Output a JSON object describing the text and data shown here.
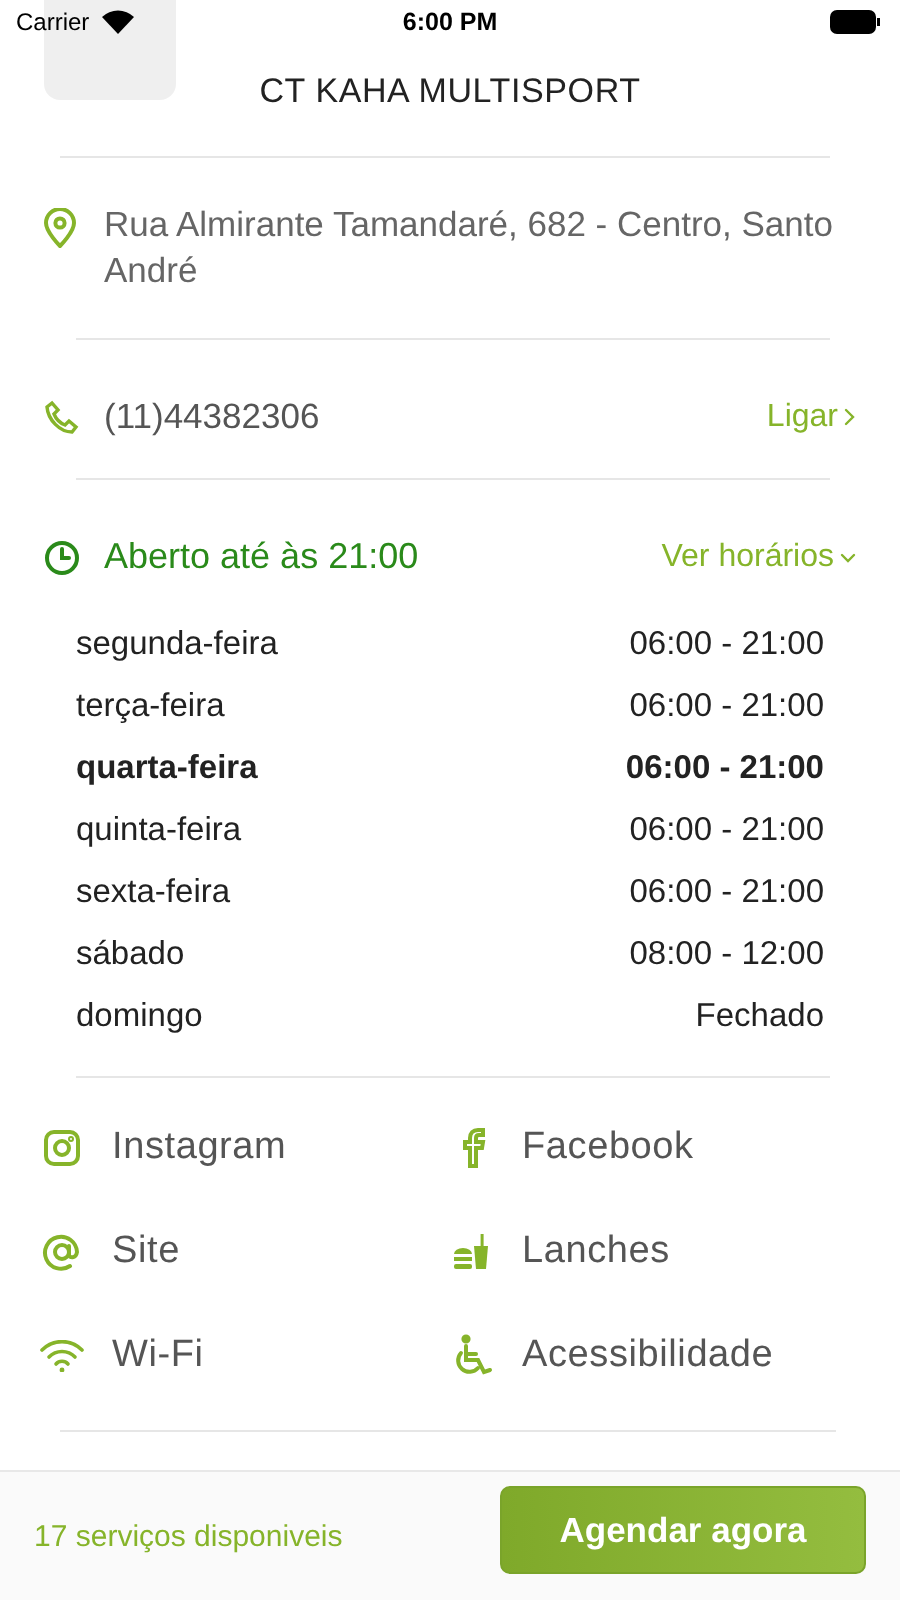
{
  "status_bar": {
    "carrier": "Carrier",
    "time": "6:00 PM"
  },
  "header": {
    "title": "CT KAHA MULTISPORT"
  },
  "address": {
    "text": "Rua Almirante Tamandaré, 682 - Centro, Santo André"
  },
  "phone": {
    "number": "(11)44382306",
    "action": "Ligar"
  },
  "hours": {
    "status": "Aberto até às 21:00",
    "toggle": "Ver horários",
    "expanded": true,
    "days": [
      {
        "day": "segunda-feira",
        "time": "06:00 - 21:00",
        "selected": false
      },
      {
        "day": "terça-feira",
        "time": "06:00 - 21:00",
        "selected": false
      },
      {
        "day": "quarta-feira",
        "time": "06:00 - 21:00",
        "selected": true
      },
      {
        "day": "quinta-feira",
        "time": "06:00 - 21:00",
        "selected": false
      },
      {
        "day": "sexta-feira",
        "time": "06:00 - 21:00",
        "selected": false
      },
      {
        "day": "sábado",
        "time": "08:00 - 12:00",
        "selected": false
      },
      {
        "day": "domingo",
        "time": "Fechado",
        "selected": false
      }
    ]
  },
  "amenities": [
    {
      "kind": "instagram",
      "label": "Instagram"
    },
    {
      "kind": "facebook",
      "label": "Facebook"
    },
    {
      "kind": "site",
      "label": "Site"
    },
    {
      "kind": "food",
      "label": "Lanches"
    },
    {
      "kind": "wifi",
      "label": "Wi-Fi"
    },
    {
      "kind": "accessibility",
      "label": "Acessibilidade"
    }
  ],
  "footer": {
    "services": "17 serviços disponiveis",
    "button": "Agendar agora"
  }
}
